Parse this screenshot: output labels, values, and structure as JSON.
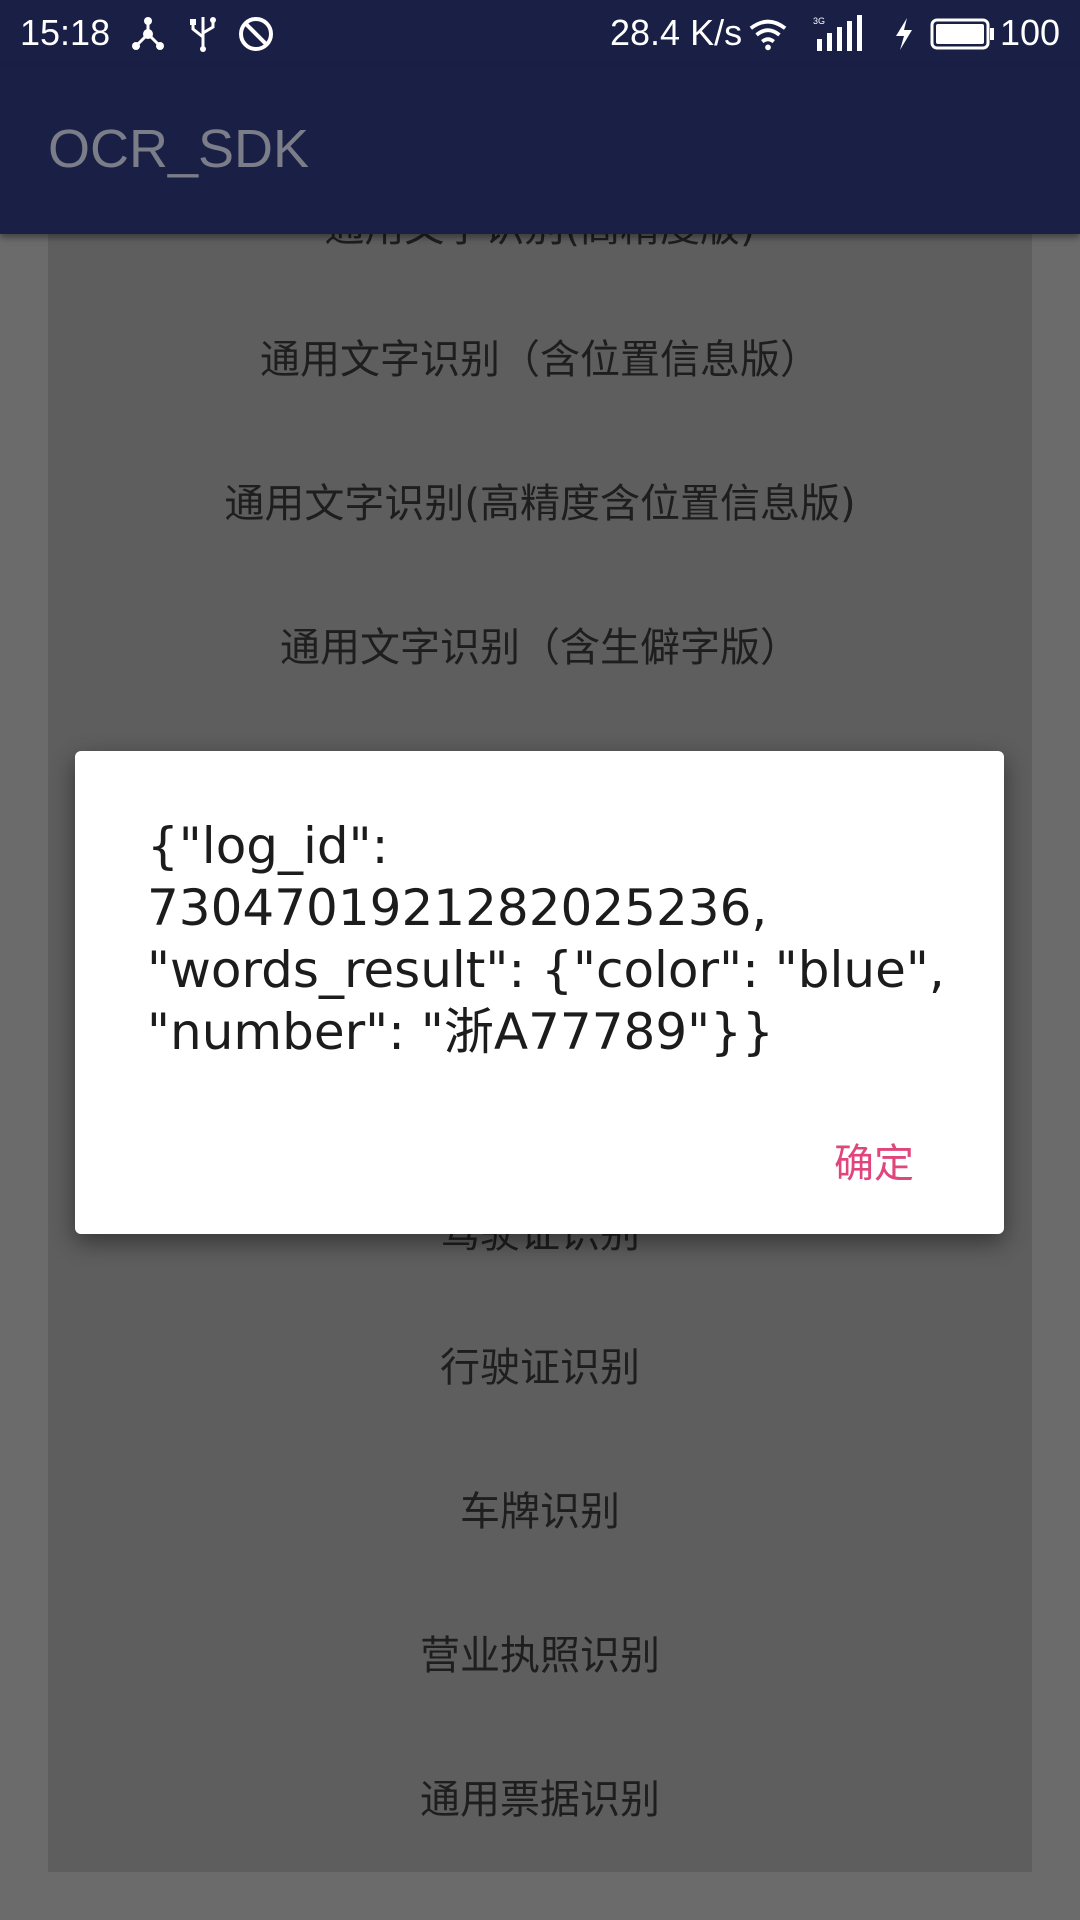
{
  "status_bar": {
    "time": "15:18",
    "speed": "28.4 K/s",
    "battery": "100",
    "icons": [
      "share-icon",
      "usb-icon",
      "blocked-icon",
      "wifi-icon",
      "signal-icon",
      "charging-icon",
      "battery-icon"
    ]
  },
  "app_bar": {
    "title": "OCR_SDK"
  },
  "list": {
    "items": [
      "通用文字识别(高精度版)",
      "通用文字识别（含位置信息版）",
      "通用文字识别(高精度含位置信息版)",
      "通用文字识别（含生僻字版）",
      "驾驶证识别",
      "行驶证识别",
      "车牌识别",
      "营业执照识别",
      "通用票据识别"
    ]
  },
  "dialog": {
    "message_lines": [
      "{\"log_id\":",
      "7304701921282025236,",
      "\"words_result\": {\"color\": \"blue\",",
      "\"number\": \"浙A77789\"}}"
    ],
    "ok_label": "确定"
  },
  "colors": {
    "app_bar": "#1a1f45",
    "accent": "#e0457b",
    "scrim": "#6b6b6b"
  }
}
